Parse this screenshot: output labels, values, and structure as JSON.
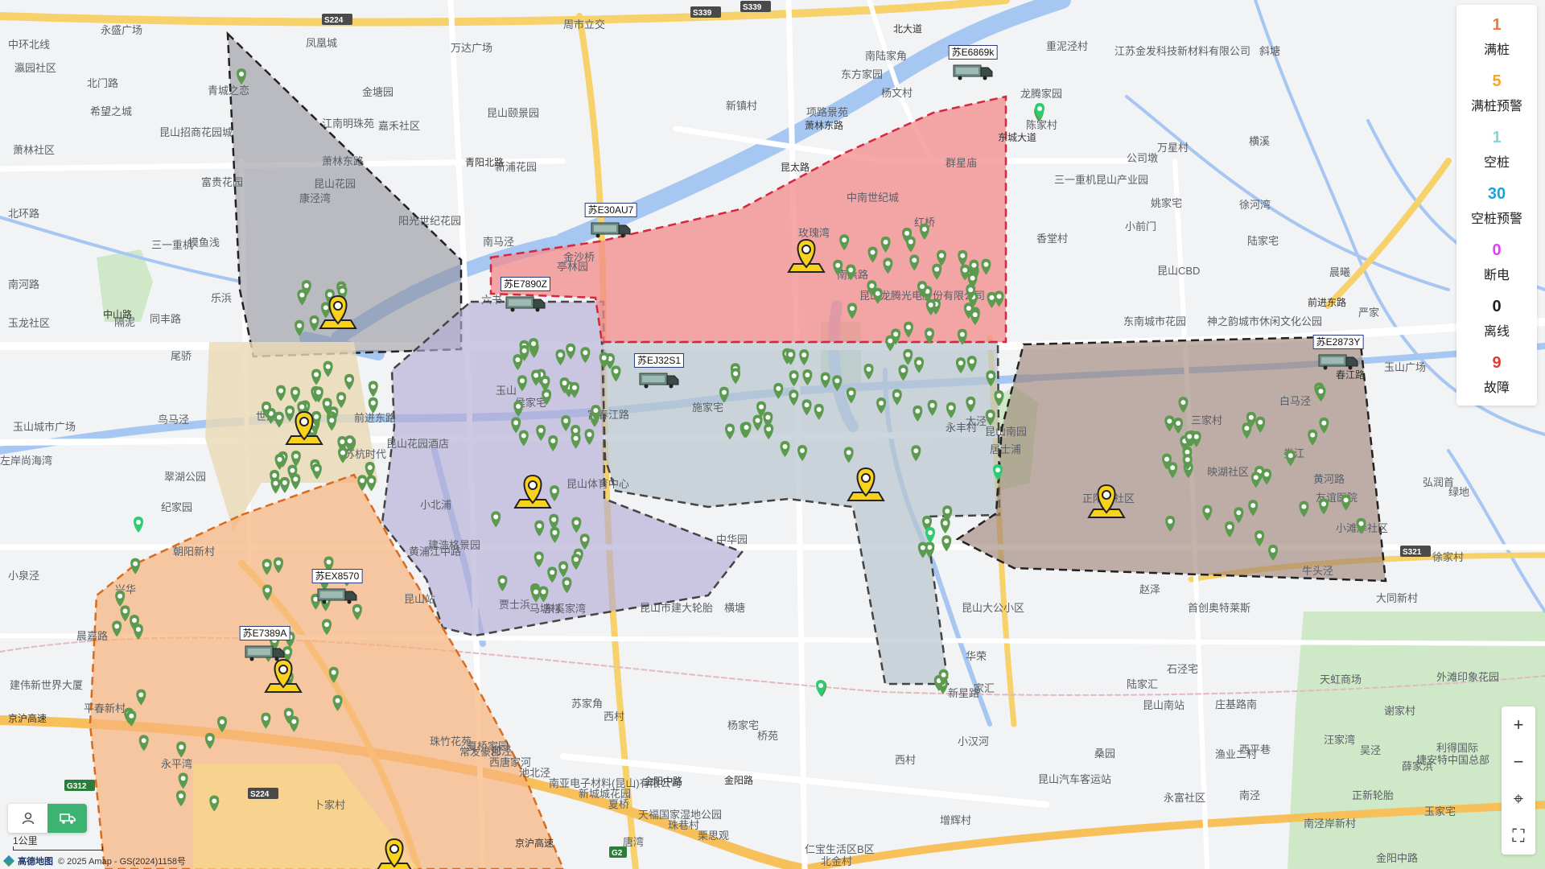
{
  "status_panel": [
    {
      "count": "1",
      "label": "满桩",
      "color": "#f07a3a"
    },
    {
      "count": "5",
      "label": "满桩预警",
      "color": "#f5a623"
    },
    {
      "count": "1",
      "label": "空桩",
      "color": "#7fd8e0"
    },
    {
      "count": "30",
      "label": "空桩预警",
      "color": "#1aa3d9"
    },
    {
      "count": "0",
      "label": "断电",
      "color": "#e040fb"
    },
    {
      "count": "0",
      "label": "离线",
      "color": "#222222"
    },
    {
      "count": "9",
      "label": "故障",
      "color": "#e53935"
    }
  ],
  "vehicles": [
    {
      "plate": "苏E6869k"
    },
    {
      "plate": "苏E30AU7"
    },
    {
      "plate": "苏E7890Z"
    },
    {
      "plate": "苏EJ32S1"
    },
    {
      "plate": "苏E2873Y"
    },
    {
      "plate": "苏EX8570"
    },
    {
      "plate": "苏E7389A"
    }
  ],
  "map_labels": {
    "places": [
      "中环北线",
      "永盛广场",
      "凤凰城",
      "周市立交",
      "万达广场",
      "南陆家角",
      "江苏金发科技新材料有限公司",
      "瀛园社区",
      "北门路",
      "青城之恋",
      "金塘园",
      "东方家园",
      "杨文村",
      "重泥泾村",
      "斜塘",
      "希望之城",
      "昆山颐景园",
      "新镇村",
      "项路景苑",
      "陈家村",
      "万星村",
      "昆山招商花园城",
      "江南明珠苑",
      "嘉禾社区",
      "龙腾家园",
      "公司墩",
      "横溪",
      "萧林社区",
      "萧林东路",
      "新浦花园",
      "群星庙",
      "三一重机昆山产业园",
      "富贵花园",
      "昆山花园",
      "中南世纪城",
      "姚家宅",
      "徐河湾",
      "北环路",
      "康泾湾",
      "阳光世纪花园",
      "玫瑰湾",
      "红桥",
      "香堂村",
      "小前门",
      "陆家宅",
      "摸鱼浅",
      "南马泾",
      "金沙桥",
      "南浜路",
      "晨曦",
      "三一重机",
      "六书",
      "亭林园",
      "昆山CBD",
      "南河路",
      "乐浜",
      "昆山龙腾光电股份有限公司",
      "严家",
      "玉龙社区",
      "同丰路",
      "东南城市花园",
      "神之韵城市休闲文化公园",
      "隔泥",
      "尾骄",
      "玉山",
      "侯家宅",
      "三家村",
      "白马泾",
      "玉山广场",
      "玉山城市广场",
      "前进东路",
      "永丰村",
      "娄江",
      "黄河路",
      "友谊医院",
      "鸟马泾",
      "世茂",
      "富春江路",
      "施家宅",
      "太泾",
      "昆山南园",
      "昆山花园酒店",
      "苏杭时代",
      "居士浦",
      "左岸尚海湾",
      "翠湖公园",
      "昆山体育中心",
      "正阳路社区",
      "映湖社区",
      "弘润首",
      "绿地",
      "纪家园",
      "建浩格景园",
      "小北浦",
      "小滩岸社区",
      "朝阳新村",
      "黄浦江中路",
      "中华园",
      "徐家村",
      "牛头泾",
      "小泉泾",
      "昆山站",
      "贾士浜",
      "赵泽",
      "首创奥特莱斯",
      "大同新村",
      "兴华",
      "东奚家湾",
      "昆山市建大轮胎",
      "横塘",
      "昆山大公小区",
      "华荣",
      "晨嘉路",
      "马塘村",
      "新星路",
      "陆家汇",
      "石泾宅",
      "天虹商场",
      "外滩印象花园",
      "建伟新世界大厦",
      "平春新村",
      "家汇",
      "昆山南站",
      "庄基路南",
      "谢家村",
      "小汉河",
      "利得国际",
      "永平湾",
      "西平巷",
      "苏家角",
      "西村",
      "桑园",
      "渔业二村",
      "汪家湾",
      "捷安特中国总部",
      "吴泾",
      "薛家浜",
      "西村",
      "河泾",
      "夏桥家园",
      "昆山汽车客运站",
      "永富社区",
      "南泾",
      "南泾岸新村",
      "正新轮胎",
      "卜家村",
      "增辉村",
      "玉家宅",
      "唐湾",
      "仁宝生活区B区",
      "北金村",
      "金阳中路",
      "珠竹花苑",
      "常发豪郡",
      "西唐家河",
      "池北泾",
      "南亚电子材料(昆山)有限公司",
      "新城城花园",
      "夏桥",
      "天福国家湿地公园",
      "珠巷村",
      "栗思观",
      "杨家宅",
      "桥苑"
    ],
    "roads": [
      "S224",
      "S339",
      "S339",
      "G312",
      "S224",
      "S321",
      "G2",
      "京沪高速",
      "京沪高速",
      "金阳中路",
      "金阳路",
      "中山路",
      "青阳北路",
      "昆太路",
      "北大道",
      "东城大道",
      "萧林东路",
      "前进东路",
      "春江路"
    ]
  },
  "attribution": {
    "brand": "高德地图",
    "text": "© 2025 Amap - GS(2024)1158号"
  },
  "scale": {
    "label": "1公里"
  },
  "controls": {
    "zoom_in": "+",
    "zoom_out": "−",
    "locate": "⌖",
    "fullscreen": "⛶"
  }
}
